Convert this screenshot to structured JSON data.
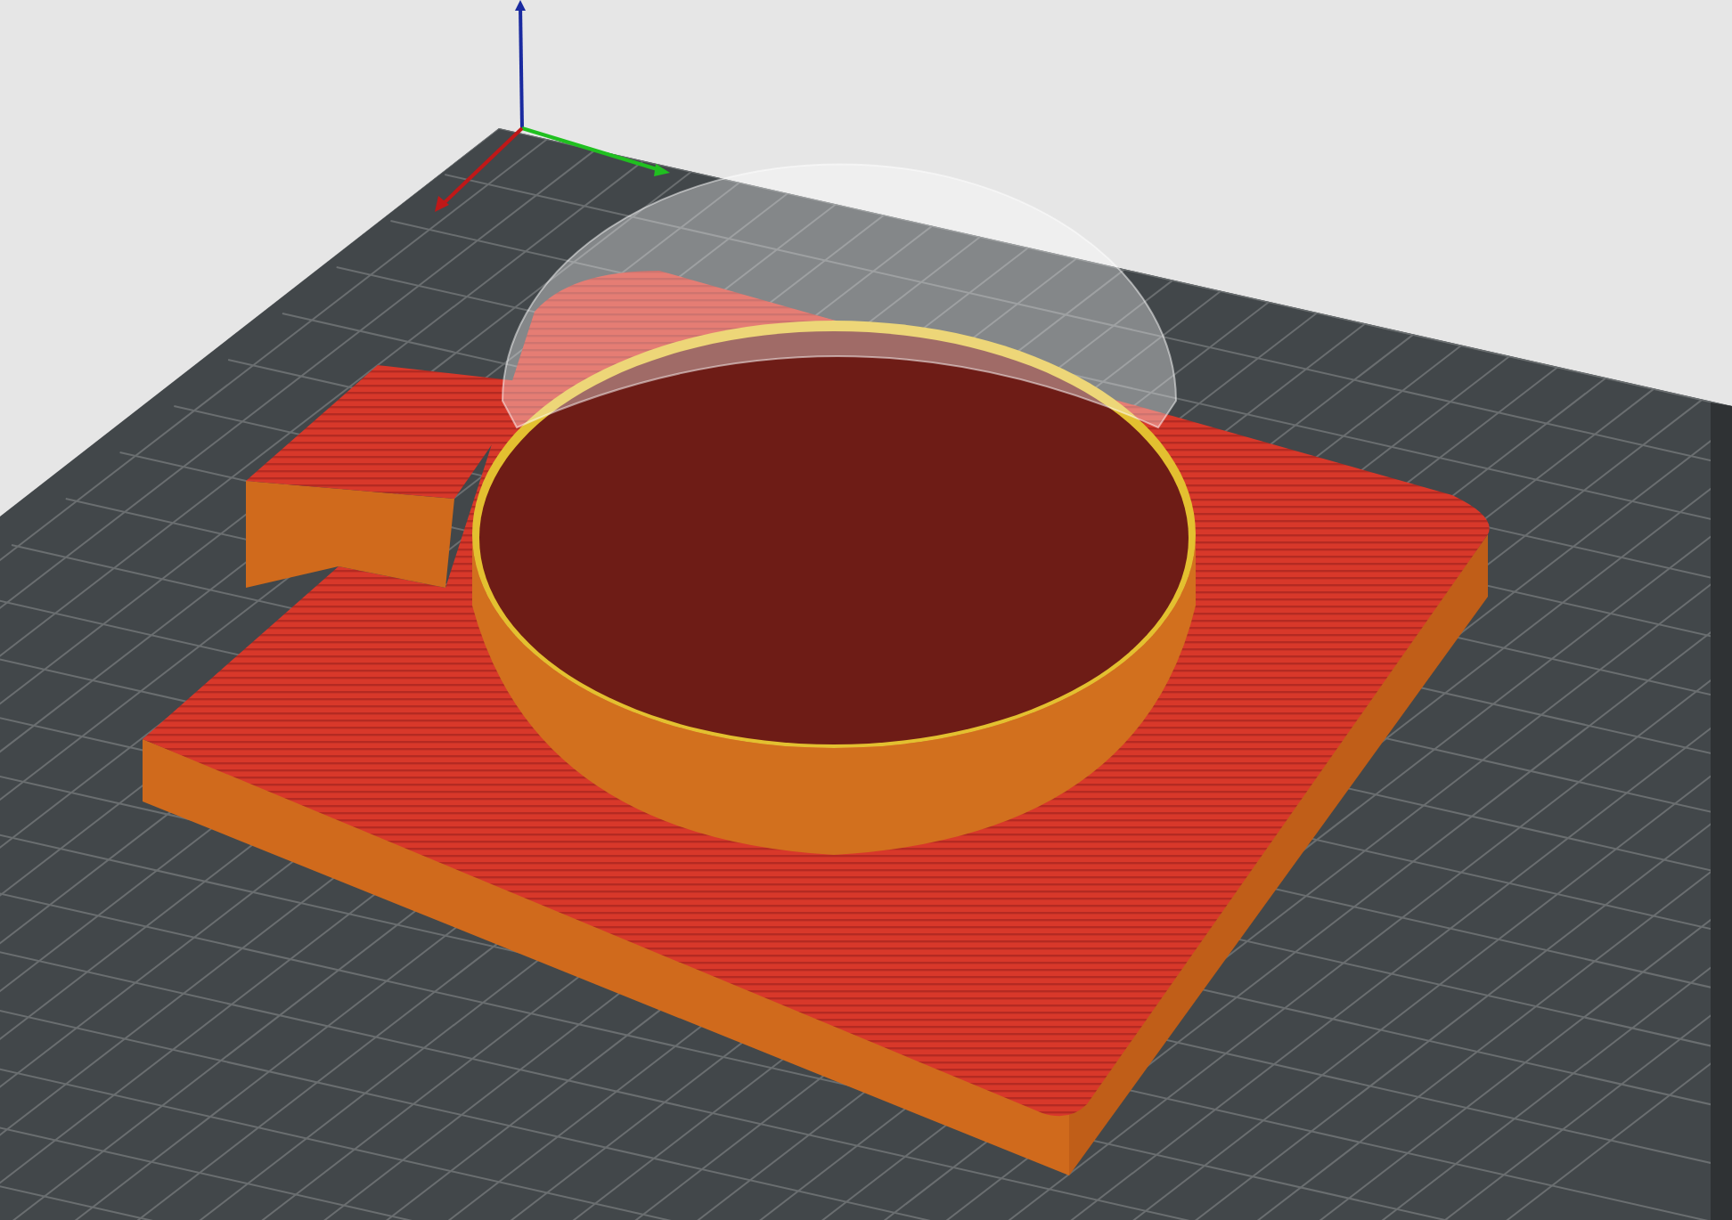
{
  "viewport": {
    "kind": "sliced-preview"
  }
}
